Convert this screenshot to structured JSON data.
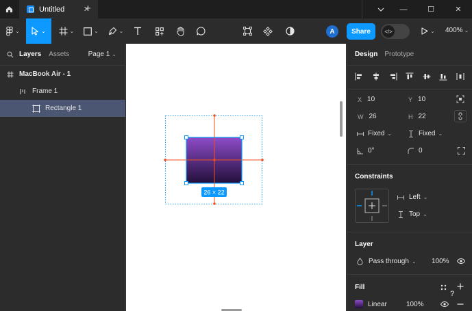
{
  "titlebar": {
    "tab_title": "Untitled",
    "tab_close": "✕",
    "new_tab": "+",
    "minimize": "—",
    "maximize": "☐",
    "close": "✕"
  },
  "toolbar": {
    "avatar_initial": "A",
    "share_label": "Share",
    "dev_mode_glyph": "</>",
    "zoom_label": "400%"
  },
  "left_panel": {
    "tabs": {
      "layers": "Layers",
      "assets": "Assets"
    },
    "page_selector": "Page 1",
    "layers": [
      {
        "name": "MacBook Air - 1",
        "type": "frame"
      },
      {
        "name": "Frame 1",
        "type": "auto-layout"
      },
      {
        "name": "Rectangle 1",
        "type": "rectangle",
        "selected": true
      }
    ]
  },
  "canvas": {
    "selection_size_label": "26 × 22",
    "rect_gradient_top": "#8e4cc9",
    "rect_gradient_bottom": "#22103a",
    "selection_color": "#0d99ff",
    "spacing_color": "#f24e1e"
  },
  "right_panel": {
    "tabs": {
      "design": "Design",
      "prototype": "Prototype"
    },
    "position": {
      "x_label": "X",
      "x": "10",
      "y_label": "Y",
      "y": "10"
    },
    "size": {
      "w_label": "W",
      "w": "26",
      "h_label": "H",
      "h": "22"
    },
    "resizing": {
      "horizontal": "Fixed",
      "vertical": "Fixed"
    },
    "rotation": "0°",
    "corner_radius": "0",
    "constraints": {
      "title": "Constraints",
      "horizontal": "Left",
      "vertical": "Top"
    },
    "layer": {
      "title": "Layer",
      "blend_mode": "Pass through",
      "opacity": "100%"
    },
    "fill": {
      "title": "Fill",
      "type": "Linear",
      "opacity": "100%",
      "help": "?"
    }
  },
  "colors": {
    "accent": "#0d99ff",
    "panel_bg": "#2c2c2c",
    "titlebar_bg": "#1e1e1e",
    "selected_layer_bg": "#4b5673"
  }
}
